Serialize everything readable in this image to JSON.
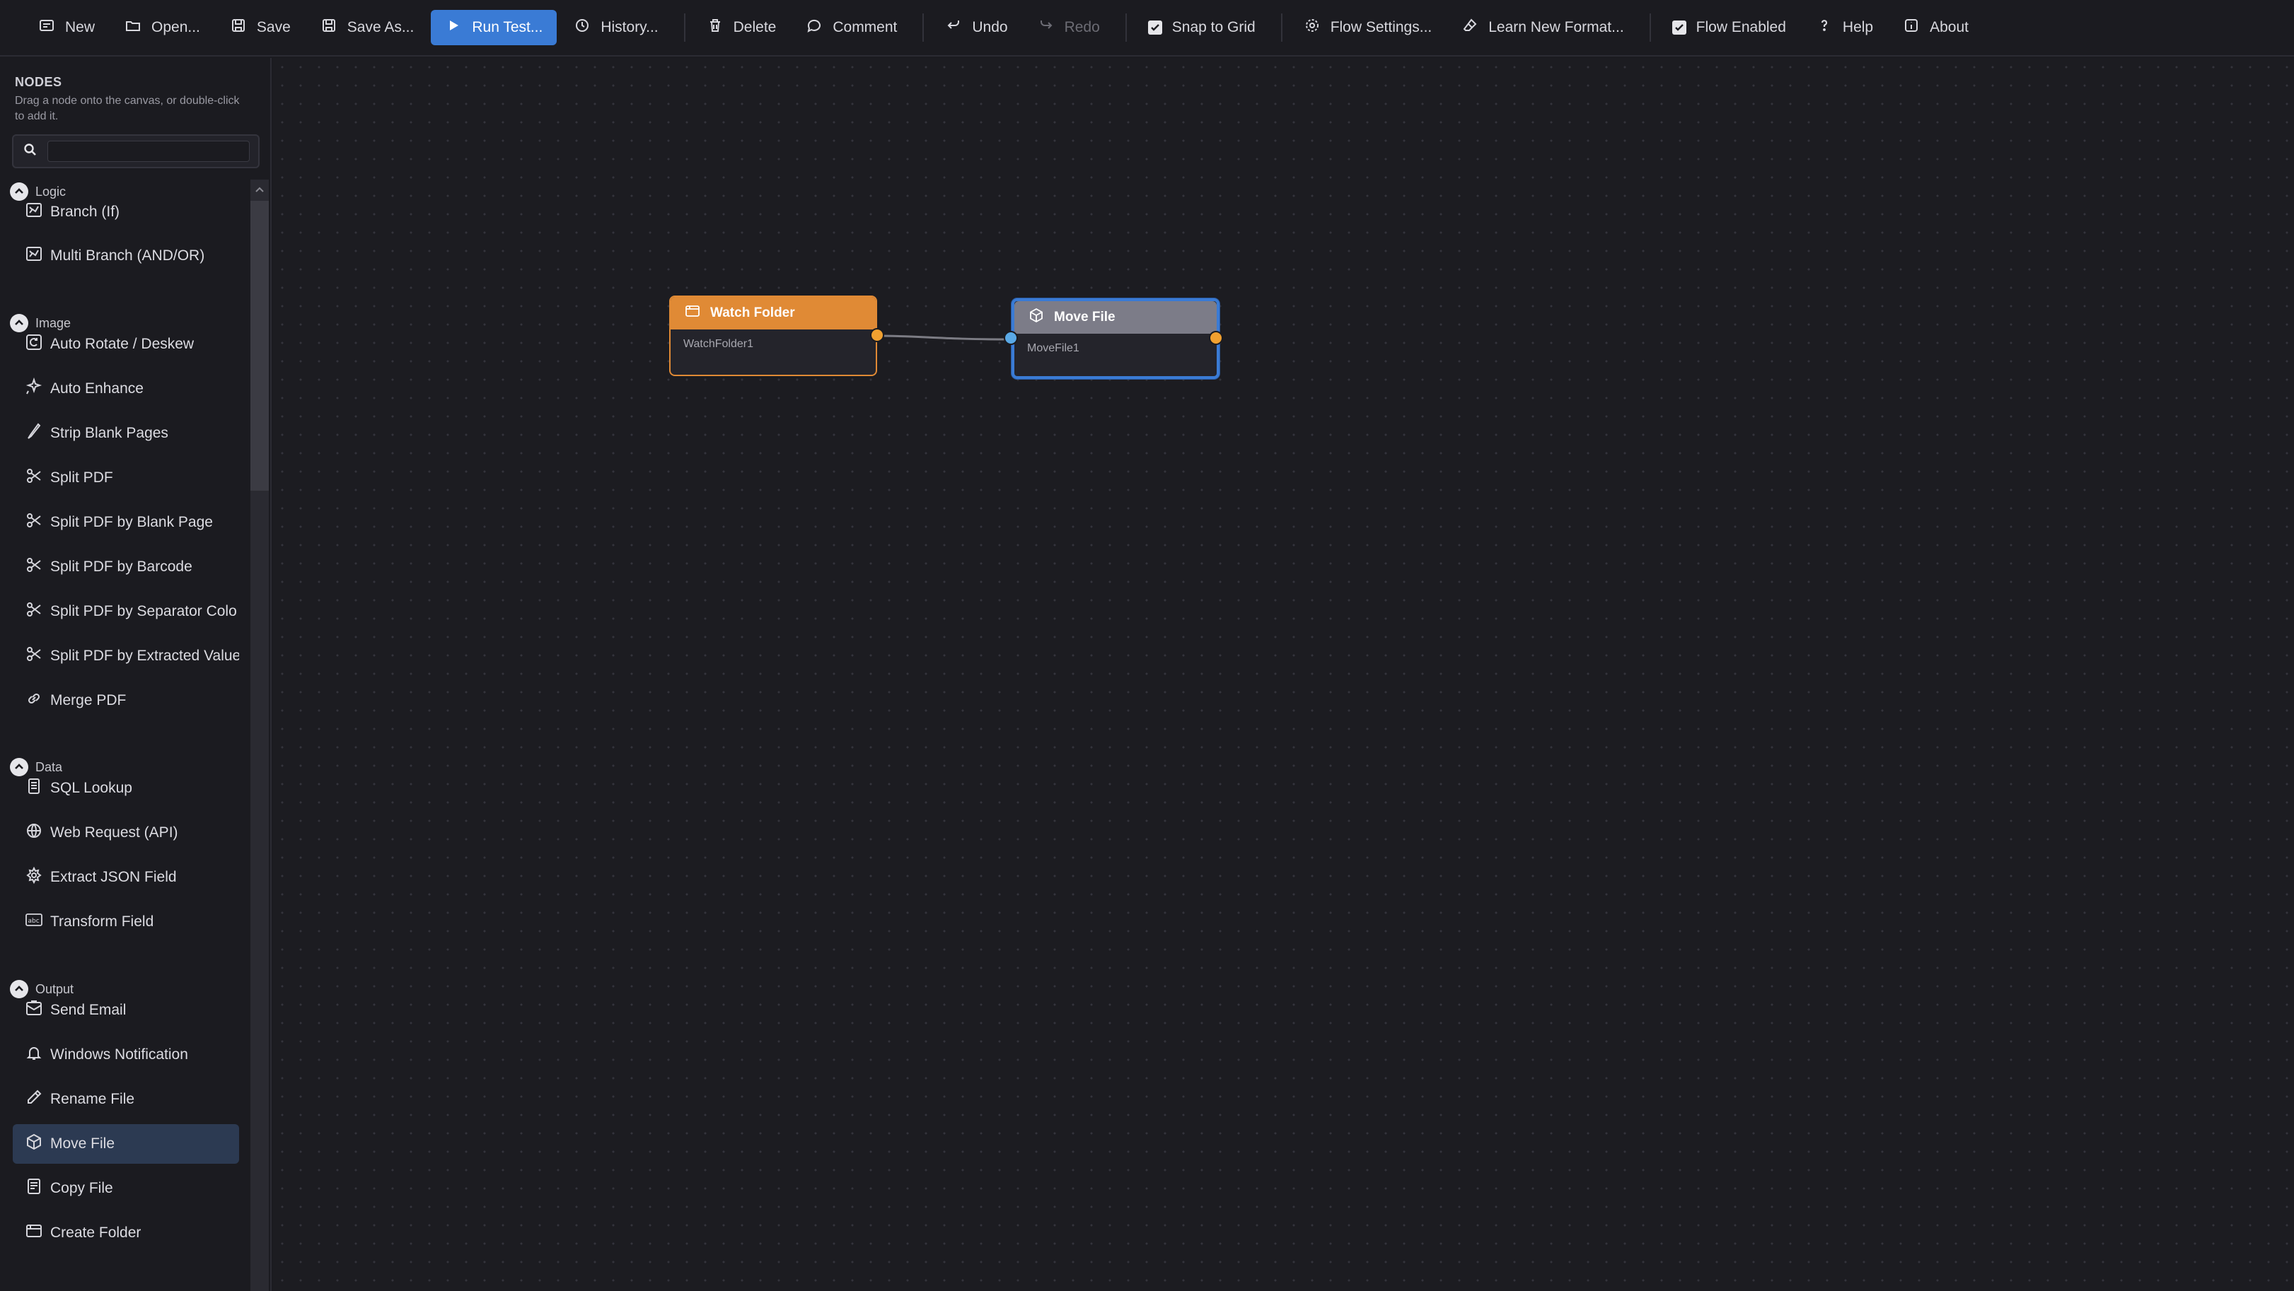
{
  "toolbar": {
    "new": "New",
    "open": "Open...",
    "save": "Save",
    "save_as": "Save As...",
    "run_test": "Run Test...",
    "history": "History...",
    "delete": "Delete",
    "comment": "Comment",
    "undo": "Undo",
    "redo": "Redo",
    "snap_to_grid": "Snap to Grid",
    "flow_settings": "Flow Settings...",
    "learn_new_format": "Learn New Format...",
    "flow_enabled": "Flow Enabled",
    "help": "Help",
    "about": "About"
  },
  "sidebar": {
    "title": "NODES",
    "help": "Drag a node onto the canvas, or double-click to add it.",
    "search_value": "",
    "categories": [
      {
        "label": "Logic",
        "items": [
          {
            "label": "Branch (If)",
            "icon": "branch-icon"
          },
          {
            "label": "Multi Branch (AND/OR)",
            "icon": "branch-icon"
          }
        ]
      },
      {
        "label": "Image",
        "items": [
          {
            "label": "Auto Rotate / Deskew",
            "icon": "rotate-icon"
          },
          {
            "label": "Auto Enhance",
            "icon": "sparkle-icon"
          },
          {
            "label": "Strip Blank Pages",
            "icon": "eraser-icon"
          },
          {
            "label": "Split PDF",
            "icon": "scissors-icon"
          },
          {
            "label": "Split PDF by Blank Page",
            "icon": "scissors-icon"
          },
          {
            "label": "Split PDF by Barcode",
            "icon": "scissors-icon"
          },
          {
            "label": "Split PDF by Separator Colo",
            "icon": "scissors-icon"
          },
          {
            "label": "Split PDF by Extracted Value",
            "icon": "scissors-icon"
          },
          {
            "label": "Merge PDF",
            "icon": "link-icon"
          }
        ]
      },
      {
        "label": "Data",
        "items": [
          {
            "label": "SQL Lookup",
            "icon": "database-icon"
          },
          {
            "label": "Web Request (API)",
            "icon": "globe-icon"
          },
          {
            "label": "Extract JSON Field",
            "icon": "json-icon"
          },
          {
            "label": "Transform Field",
            "icon": "text-field-icon"
          }
        ]
      },
      {
        "label": "Output",
        "items": [
          {
            "label": "Send Email",
            "icon": "email-icon"
          },
          {
            "label": "Windows Notification",
            "icon": "bell-icon"
          },
          {
            "label": "Rename File",
            "icon": "pencil-icon"
          },
          {
            "label": "Move File",
            "icon": "cube-icon",
            "selected": true
          },
          {
            "label": "Copy File",
            "icon": "copy-icon"
          },
          {
            "label": "Create Folder",
            "icon": "folder-plus-icon"
          }
        ]
      }
    ]
  },
  "canvas": {
    "nodes": [
      {
        "title": "Watch Folder",
        "name": "WatchFolder1",
        "color": "#e08a35",
        "icon": "folder-icon"
      },
      {
        "title": "Move File",
        "name": "MoveFile1",
        "color": "#7c7c88",
        "icon": "cube-icon",
        "selected": true
      }
    ]
  },
  "colors": {
    "accent": "#3a7bd5",
    "port_output": "#f0a030",
    "port_input": "#5aa9e6",
    "watch_folder": "#e08a35",
    "selection": "#3a7bd5"
  }
}
